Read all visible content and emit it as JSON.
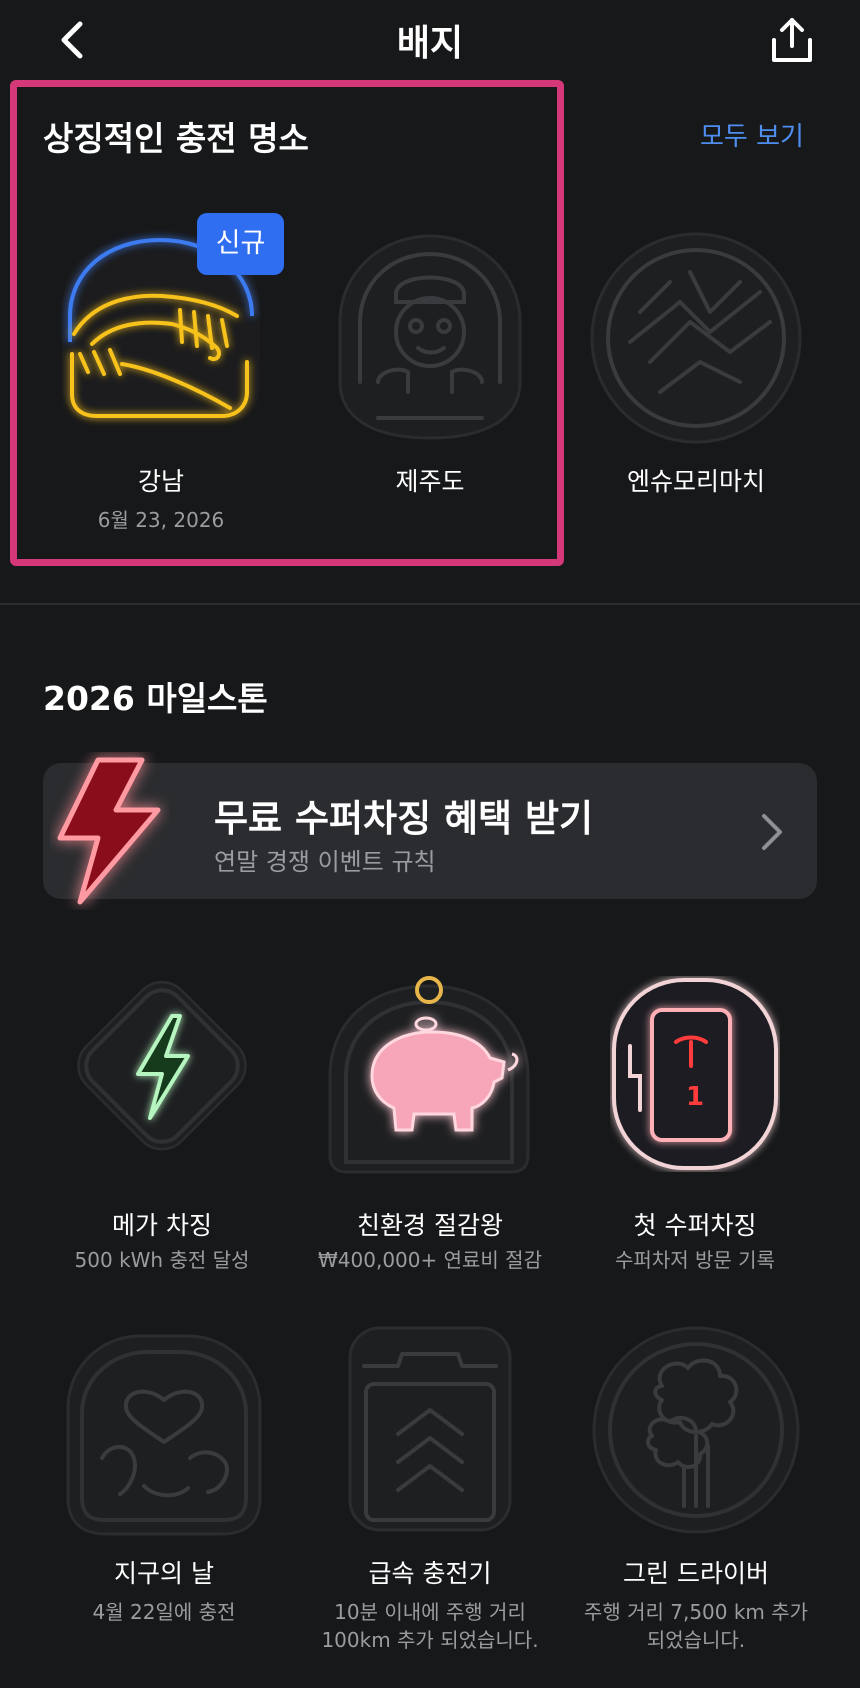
{
  "header": {
    "title": "배지",
    "back_icon": "chevron-left-icon",
    "share_icon": "share-icon"
  },
  "iconic": {
    "title": "상징적인 충전 명소",
    "see_all": "모두 보기",
    "new_label": "신규",
    "items": [
      {
        "name": "강남",
        "date": "6월 23, 2026",
        "state": "earned"
      },
      {
        "name": "제주도",
        "date": "",
        "state": "locked"
      },
      {
        "name": "엔슈모리마치",
        "date": "",
        "state": "locked"
      }
    ]
  },
  "milestones": {
    "title": "2026 마일스톤",
    "promo": {
      "title": "무료 수퍼차징 혜택 받기",
      "subtitle": "연말 경쟁 이벤트 규칙"
    },
    "items": [
      {
        "name": "메가 차징",
        "desc": "500 kWh 충전 달성",
        "state": "earned"
      },
      {
        "name": "친환경 절감왕",
        "desc": "₩400,000+ 연료비 절감",
        "state": "earned"
      },
      {
        "name": "첫 수퍼차징",
        "desc": "수퍼차저 방문 기록",
        "state": "earned",
        "badge_number": "1"
      },
      {
        "name": "지구의 날",
        "desc": "4월 22일에 충전",
        "state": "locked"
      },
      {
        "name": "급속 충전기",
        "desc": "10분 이내에 주행 거리 100km 추가 되었습니다.",
        "state": "locked"
      },
      {
        "name": "그린 드라이버",
        "desc": "주행 거리 7,500 km 추가 되었습니다.",
        "state": "locked"
      }
    ]
  },
  "colors": {
    "background": "#17181a",
    "accent": "#4e8ef0",
    "highlight": "#d53879",
    "new_badge": "#2f6ef0"
  }
}
